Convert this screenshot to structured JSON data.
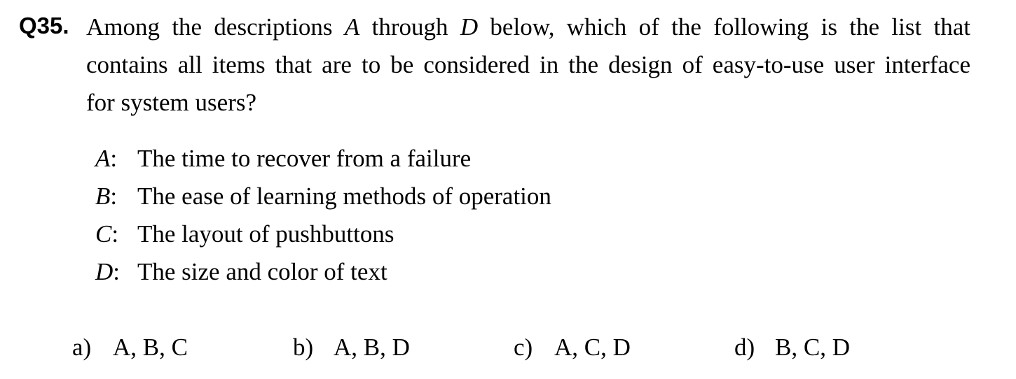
{
  "question": {
    "number": "Q35.",
    "lines": [
      "Among the descriptions A through D below, which of the following is the list that",
      "contains all items that are to be considered in the design of easy-to-use user interface",
      "for system users?"
    ]
  },
  "items": [
    {
      "key": "A",
      "sep": ":",
      "text": "The time to recover from a failure"
    },
    {
      "key": "B",
      "sep": ":",
      "text": "The ease of learning methods of operation"
    },
    {
      "key": "C",
      "sep": ":",
      "text": "The layout of pushbuttons"
    },
    {
      "key": "D",
      "sep": ":",
      "text": "The size and color of text"
    }
  ],
  "options": [
    {
      "letter": "a)",
      "text": "A, B, C"
    },
    {
      "letter": "b)",
      "text": "A, B, D"
    },
    {
      "letter": "c)",
      "text": "A, C, D"
    },
    {
      "letter": "d)",
      "text": "B, C, D"
    }
  ]
}
